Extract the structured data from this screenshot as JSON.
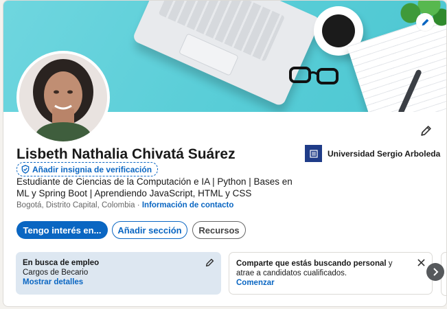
{
  "profile": {
    "name": "Lisbeth Nathalia Chivatá Suárez",
    "verify_badge_label": "Añadir insignia de verificación",
    "headline": "Estudiante de Ciencias de la Computación e IA | Python | Bases en ML y Spring Boot | Aprendiendo JavaScript, HTML y CSS",
    "location": "Bogotá, Distrito Capital, Colombia",
    "location_separator": "·",
    "contact_link": "Información de contacto"
  },
  "education": {
    "name": "Universidad Sergio Arboleda"
  },
  "actions": {
    "open_to": "Tengo interés en...",
    "add_section": "Añadir sección",
    "resources": "Recursos"
  },
  "cards": {
    "open_to_work": {
      "title": "En busca de empleo",
      "subtitle": "Cargos de Becario",
      "link": "Mostrar detalles"
    },
    "hiring": {
      "text_bold": "Comparte que estás buscando personal",
      "text_rest": " y atrae a candidatos cualificados.",
      "link": "Comenzar"
    }
  },
  "icons": {
    "banner_edit": "pencil-icon",
    "profile_edit": "pencil-icon",
    "verify": "shield-check-icon",
    "card_edit": "pencil-icon",
    "card_close": "close-icon",
    "carousel_next": "chevron-right-icon"
  },
  "colors": {
    "accent": "#0a66c2",
    "card_highlight": "#dde7f1",
    "banner": "#58cdd7"
  }
}
